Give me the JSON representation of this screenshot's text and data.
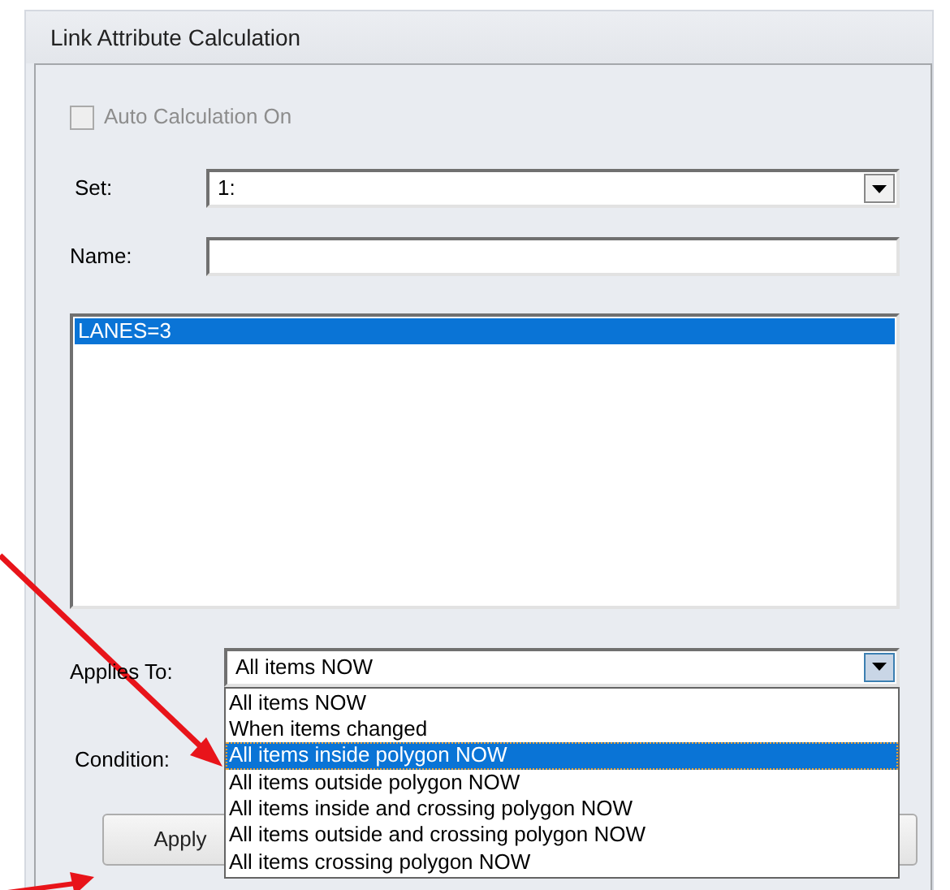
{
  "panel": {
    "title": "Link Attribute Calculation"
  },
  "auto_calculation": {
    "label": "Auto Calculation On",
    "checked": false,
    "disabled": true
  },
  "set": {
    "label": "Set:",
    "value": "1:"
  },
  "name": {
    "label": "Name:"
  },
  "expressions": [
    {
      "text": "LANES=3",
      "selected": true
    }
  ],
  "applies_to": {
    "label": "Applies To:",
    "value": "All items NOW",
    "expanded": true,
    "options": [
      {
        "text": "All items NOW",
        "highlighted": false
      },
      {
        "text": "When items changed",
        "highlighted": false
      },
      {
        "text": "All items inside polygon NOW",
        "highlighted": true
      },
      {
        "text": "All items outside polygon NOW",
        "highlighted": false
      },
      {
        "text": "All items inside and crossing polygon NOW",
        "highlighted": false
      },
      {
        "text": "All items outside and crossing polygon NOW",
        "highlighted": false
      },
      {
        "text": "All items crossing polygon NOW",
        "highlighted": false
      }
    ]
  },
  "condition": {
    "label": "Condition:"
  },
  "buttons": [
    {
      "label": "Apply"
    }
  ]
}
